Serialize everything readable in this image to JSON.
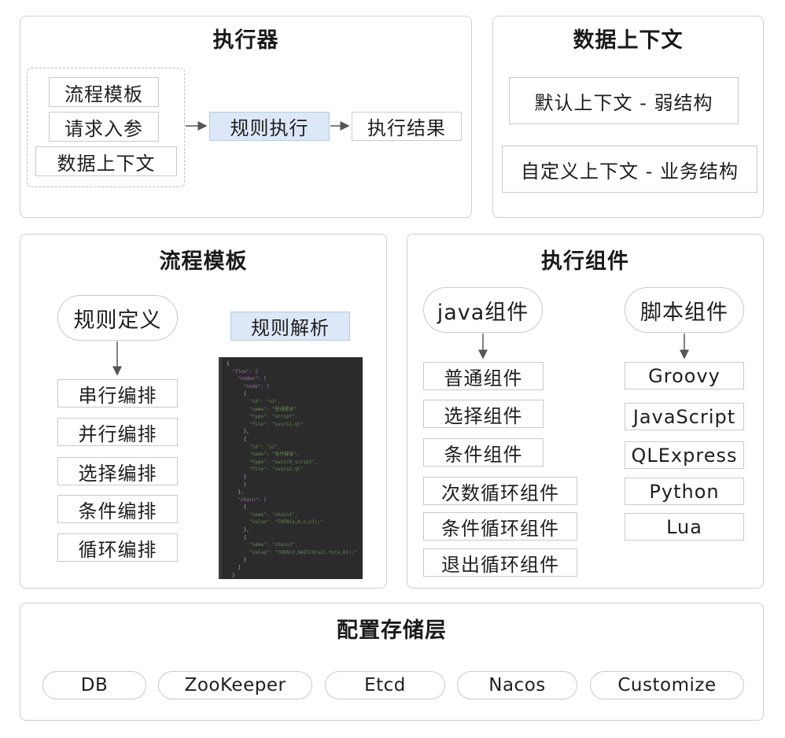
{
  "executor": {
    "title": "执行器",
    "inputs": [
      "流程模板",
      "请求入参",
      "数据上下文"
    ],
    "rule_exec": "规则执行",
    "result": "执行结果"
  },
  "context": {
    "title": "数据上下文",
    "items": [
      "默认上下文 - 弱结构",
      "自定义上下文 - 业务结构"
    ]
  },
  "template": {
    "title": "流程模板",
    "rule_def": "规则定义",
    "rule_parse": "规则解析",
    "arrangements": [
      "串行编排",
      "并行编排",
      "选择编排",
      "条件编排",
      "循环编排"
    ],
    "code_lines": [
      "{",
      "  \"flow\": {",
      "    \"nodes\": [",
      "      \"node\": [",
      "      {",
      "        \"id\": \"s1\",",
      "        \"name\": \"普通脚本\",",
      "        \"type\": \"script\",",
      "        \"file\": \"xxx/s1.ql\"",
      "      },",
      "      {",
      "        \"id\": \"s2\",",
      "        \"name\": \"条件脚本\",",
      "        \"type\": \"switch_script\",",
      "        \"file\": \"xxx/s2.ql\"",
      "      }",
      "      ]",
      "    },",
      "    \"chain\": [",
      "      {",
      "        \"name\": \"chain1\",",
      "        \"value\": \"THEN(a,b,c,s1);\"",
      "      },",
      "      {",
      "        \"name\": \"chain2\",",
      "        \"value\": \"THEN(d,SWITCH(s2).to(a,b));\"",
      "      }",
      "    ]",
      "  }",
      "}"
    ]
  },
  "components": {
    "title": "执行组件",
    "java": {
      "label": "java组件",
      "items": [
        "普通组件",
        "选择组件",
        "条件组件",
        "次数循环组件",
        "条件循环组件",
        "退出循环组件"
      ]
    },
    "script": {
      "label": "脚本组件",
      "items": [
        "Groovy",
        "JavaScript",
        "QLExpress",
        "Python",
        "Lua"
      ]
    }
  },
  "storage": {
    "title": "配置存储层",
    "items": [
      "DB",
      "ZooKeeper",
      "Etcd",
      "Nacos",
      "Customize"
    ]
  }
}
